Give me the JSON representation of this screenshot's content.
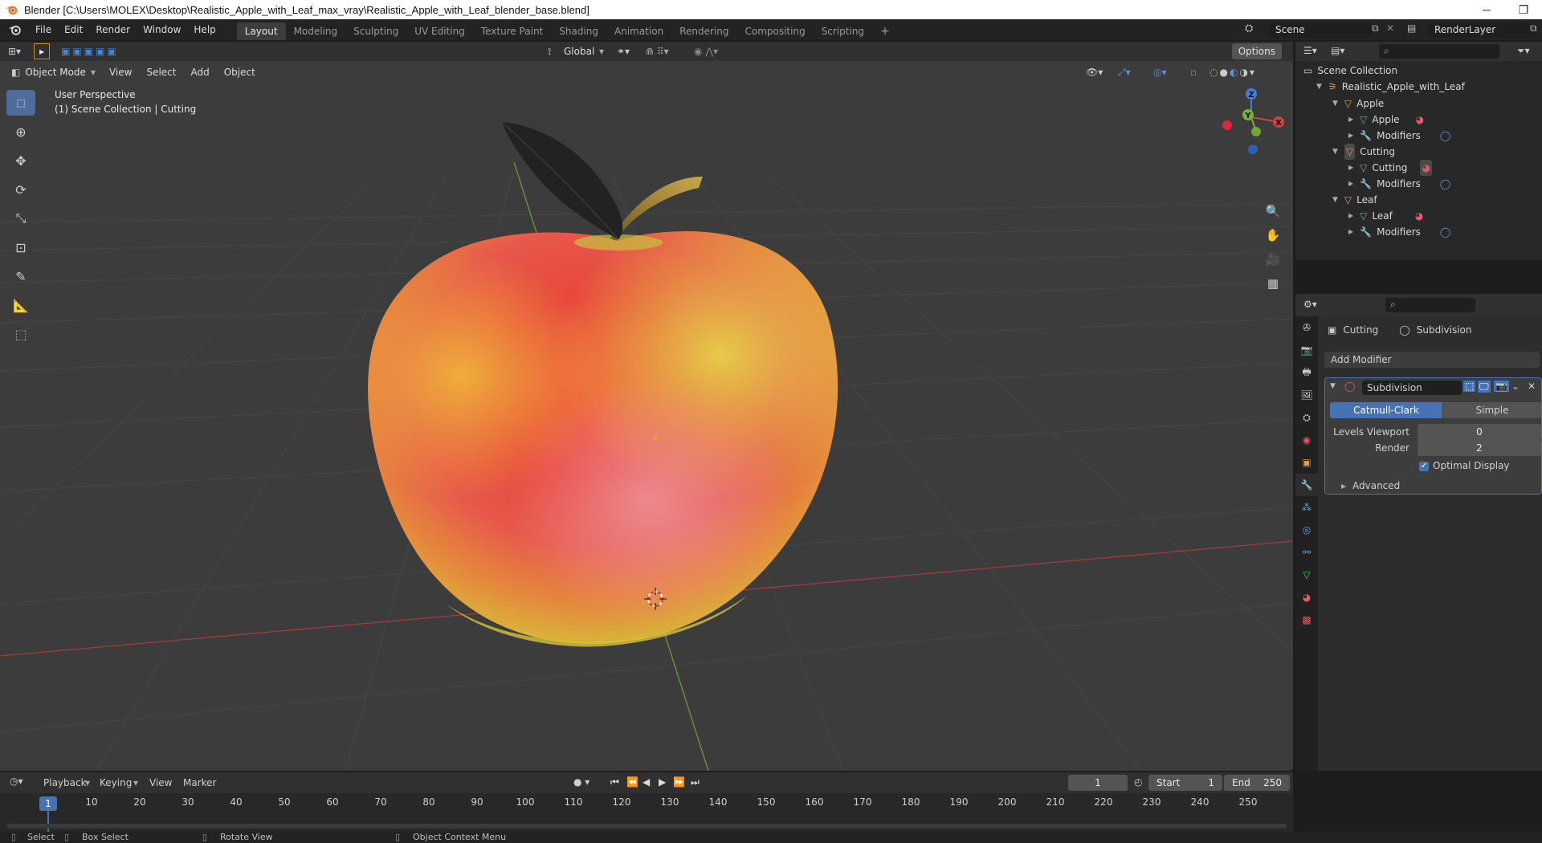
{
  "window": {
    "title": "Blender [C:\\Users\\MOLEX\\Desktop\\Realistic_Apple_with_Leaf_max_vray\\Realistic_Apple_with_Leaf_blender_base.blend]",
    "minimize": "─",
    "restore": "❐"
  },
  "menubar": {
    "items": [
      "File",
      "Edit",
      "Render",
      "Window",
      "Help"
    ],
    "workspaces": [
      "Layout",
      "Modeling",
      "Sculpting",
      "UV Editing",
      "Texture Paint",
      "Shading",
      "Animation",
      "Rendering",
      "Compositing",
      "Scripting"
    ],
    "add_tab": "+",
    "scene": "Scene",
    "render_layer": "RenderLayer"
  },
  "viewport": {
    "mode": "Object Mode",
    "menus": [
      "View",
      "Select",
      "Add",
      "Object"
    ],
    "orientation": "Global",
    "options": "Options",
    "perspective": "User Perspective",
    "collection_info": "(1) Scene Collection | Cutting",
    "gizmo": {
      "z": "Z",
      "y": "Y",
      "x": "X"
    }
  },
  "outliner": {
    "root": "Scene Collection",
    "collection": "Realistic_Apple_with_Leaf",
    "objects": [
      {
        "name": "Apple",
        "mesh": "Apple",
        "modifiers": "Modifiers"
      },
      {
        "name": "Cutting",
        "mesh": "Cutting",
        "modifiers": "Modifiers"
      },
      {
        "name": "Leaf",
        "mesh": "Leaf",
        "modifiers": "Modifiers"
      }
    ]
  },
  "properties": {
    "breadcrumb": {
      "object": "Cutting",
      "modifier": "Subdivision"
    },
    "add_modifier": "Add Modifier",
    "modifier": {
      "name": "Subdivision",
      "type_options": [
        "Catmull-Clark",
        "Simple"
      ],
      "levels_viewport_label": "Levels Viewport",
      "levels_viewport": "0",
      "render_label": "Render",
      "render": "2",
      "optimal_display": "Optimal Display",
      "advanced": "Advanced"
    }
  },
  "timeline": {
    "menus": [
      "Playback",
      "Keying",
      "View",
      "Marker"
    ],
    "current_frame": "1",
    "start_label": "Start",
    "start": "1",
    "end_label": "End",
    "end": "250",
    "ticks": [
      "10",
      "20",
      "30",
      "40",
      "50",
      "60",
      "70",
      "80",
      "90",
      "100",
      "110",
      "120",
      "130",
      "140",
      "150",
      "160",
      "170",
      "180",
      "190",
      "200",
      "210",
      "220",
      "230",
      "240",
      "250"
    ],
    "playhead": "1"
  },
  "statusbar": {
    "items": [
      "Select",
      "Box Select",
      "Rotate View",
      "Object Context Menu"
    ]
  },
  "colors": {
    "accent": "#4772b3",
    "active_tool": "#4e6d9c",
    "viewport_bg": "#3c3c3c",
    "x_axis": "#c84444",
    "y_axis": "#78b030",
    "z_axis": "#3f7fe0"
  }
}
